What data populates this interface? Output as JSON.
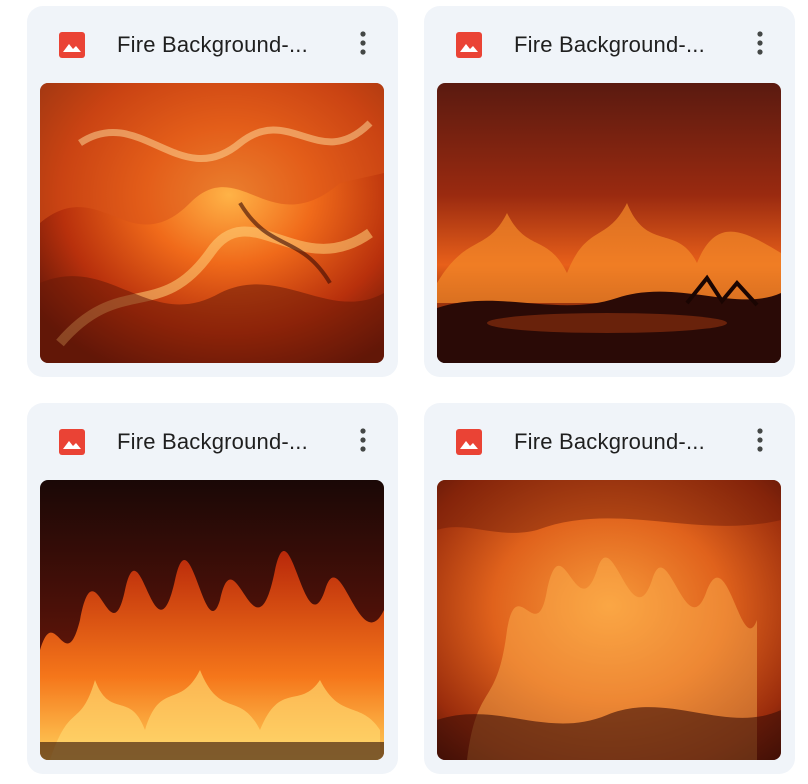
{
  "files": [
    {
      "name": "Fire Background-...",
      "icon": "image-file-icon",
      "menu_icon": "more-vert-icon"
    },
    {
      "name": "Fire Background-...",
      "icon": "image-file-icon",
      "menu_icon": "more-vert-icon"
    },
    {
      "name": "Fire Background-...",
      "icon": "image-file-icon",
      "menu_icon": "more-vert-icon"
    },
    {
      "name": "Fire Background-...",
      "icon": "image-file-icon",
      "menu_icon": "more-vert-icon"
    }
  ],
  "colors": {
    "card_bg": "#f0f4f9",
    "image_icon_red": "#ea4335",
    "title_text": "#1f1f1f"
  }
}
